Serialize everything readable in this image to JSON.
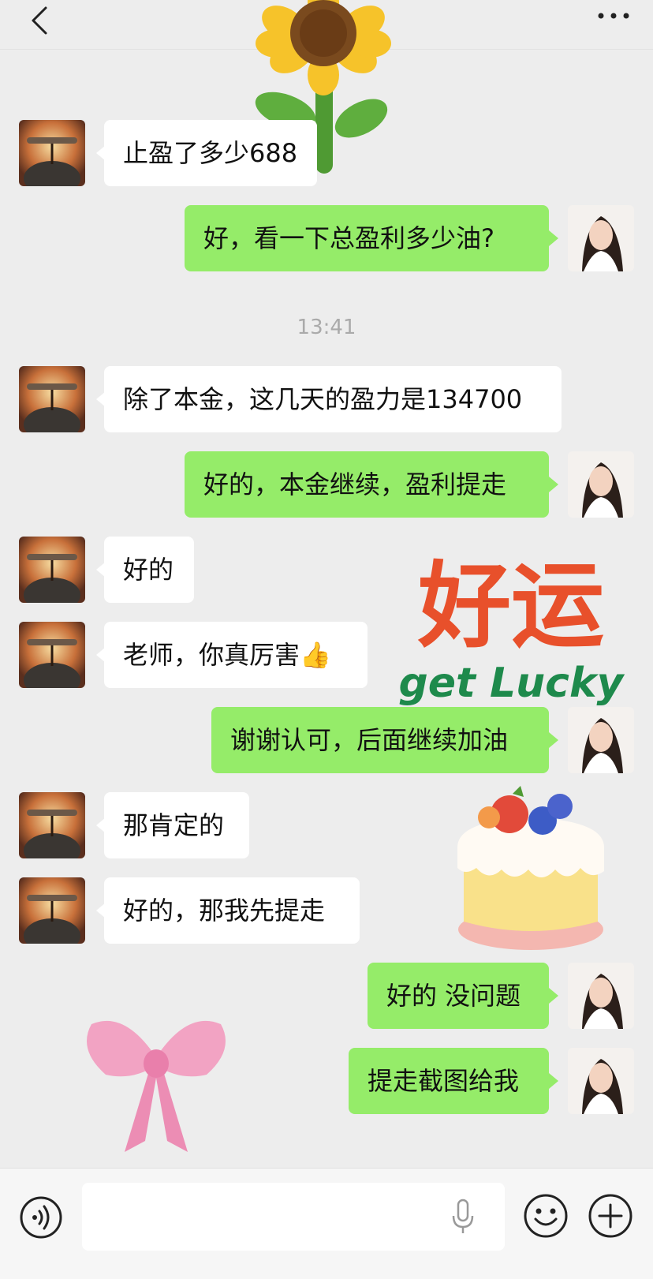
{
  "header": {
    "back_icon": "chevron-left-icon",
    "more_icon": "more-dots-icon"
  },
  "timestamp": "13:41",
  "messages": [
    {
      "side": "in",
      "text": "止盈了多少688"
    },
    {
      "side": "out",
      "text": "好，看一下总盈利多少油?"
    },
    {
      "side": "in",
      "text": "除了本金，这几天的盈力是134700"
    },
    {
      "side": "out",
      "text": "好的，本金继续，盈利提走"
    },
    {
      "side": "in",
      "text": "好的"
    },
    {
      "side": "in",
      "text": "老师，你真厉害👍"
    },
    {
      "side": "out",
      "text": "谢谢认可，后面继续加油"
    },
    {
      "side": "in",
      "text": "那肯定的"
    },
    {
      "side": "in",
      "text": "好的，那我先提走"
    },
    {
      "side": "out",
      "text": "好的 没问题"
    },
    {
      "side": "out",
      "text": "提走截图给我"
    }
  ],
  "stickers": {
    "sunflower": "sunflower-sticker",
    "lucky": {
      "big": "好运",
      "small": "get Lucky"
    },
    "cake": "cake-sticker",
    "bow": "pink-bow-sticker"
  },
  "input_bar": {
    "voice_icon": "voice-icon",
    "mic_icon": "microphone-icon",
    "emoji_icon": "emoji-icon",
    "plus_icon": "plus-icon"
  },
  "colors": {
    "background": "#ededed",
    "outgoing_bubble": "#95ec69",
    "incoming_bubble": "#ffffff",
    "lucky_red": "#e8502b",
    "lucky_green": "#1e8a4c"
  }
}
